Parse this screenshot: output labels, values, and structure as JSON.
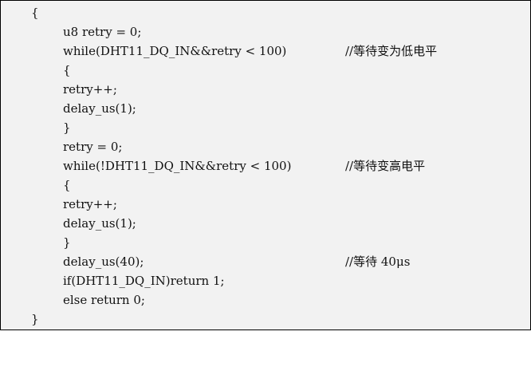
{
  "colors": {
    "box_background": "#f2f2f2",
    "border": "#000000",
    "text": "#111111"
  },
  "lines": [
    {
      "code": "{",
      "comment": ""
    },
    {
      "code": "u8 retry = 0;",
      "comment": ""
    },
    {
      "code": "while(DHT11_DQ_IN&&retry < 100)",
      "comment": "//等待变为低电平"
    },
    {
      "code": "{",
      "comment": ""
    },
    {
      "code": "retry++;",
      "comment": ""
    },
    {
      "code": "delay_us(1);",
      "comment": ""
    },
    {
      "code": "}",
      "comment": ""
    },
    {
      "code": "retry = 0;",
      "comment": ""
    },
    {
      "code": "while(!DHT11_DQ_IN&&retry < 100)",
      "comment": "//等待变高电平"
    },
    {
      "code": "{",
      "comment": ""
    },
    {
      "code": "retry++;",
      "comment": ""
    },
    {
      "code": "delay_us(1);",
      "comment": ""
    },
    {
      "code": "}",
      "comment": ""
    },
    {
      "code": "delay_us(40);",
      "comment": "//等待 40μs"
    },
    {
      "code": "if(DHT11_DQ_IN)return 1;",
      "comment": ""
    },
    {
      "code": "else return 0;",
      "comment": ""
    },
    {
      "code": "}",
      "comment": ""
    }
  ]
}
